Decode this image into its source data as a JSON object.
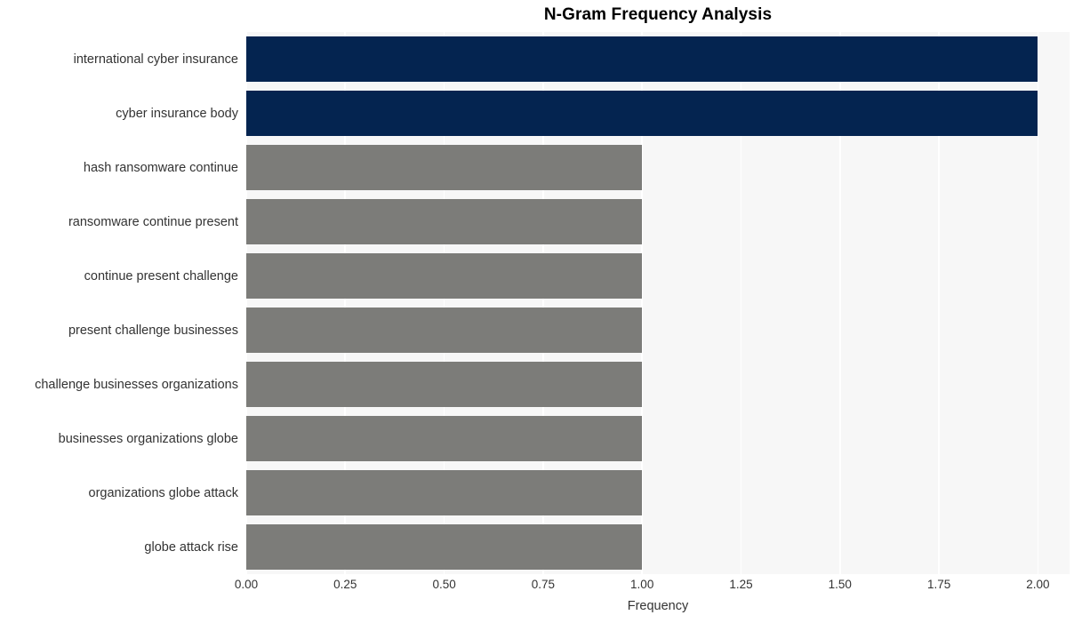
{
  "chart_data": {
    "type": "bar",
    "orientation": "horizontal",
    "title": "N-Gram Frequency Analysis",
    "xlabel": "Frequency",
    "ylabel": "",
    "categories": [
      "international cyber insurance",
      "cyber insurance body",
      "hash ransomware continue",
      "ransomware continue present",
      "continue present challenge",
      "present challenge businesses",
      "challenge businesses organizations",
      "businesses organizations globe",
      "organizations globe attack",
      "globe attack rise"
    ],
    "values": [
      2,
      2,
      1,
      1,
      1,
      1,
      1,
      1,
      1,
      1
    ],
    "bar_colors": [
      "#042450",
      "#042450",
      "#7c7c79",
      "#7c7c79",
      "#7c7c79",
      "#7c7c79",
      "#7c7c79",
      "#7c7c79",
      "#7c7c79",
      "#7c7c79"
    ],
    "xlim": [
      0,
      2.08
    ],
    "xticks": [
      0,
      0.25,
      0.5,
      0.75,
      1,
      1.25,
      1.5,
      1.75,
      2
    ],
    "xtick_labels": [
      "0.00",
      "0.25",
      "0.50",
      "0.75",
      "1.00",
      "1.25",
      "1.50",
      "1.75",
      "2.00"
    ],
    "grid": true,
    "grid_axis": "x",
    "grid_color": "#ffffff",
    "plot_background": "#f7f7f7",
    "figure_background": "#ffffff",
    "legend": null,
    "accent_color": "#042450",
    "secondary_color": "#7c7c79",
    "text_color": "#333333",
    "title_color": "#000000"
  }
}
